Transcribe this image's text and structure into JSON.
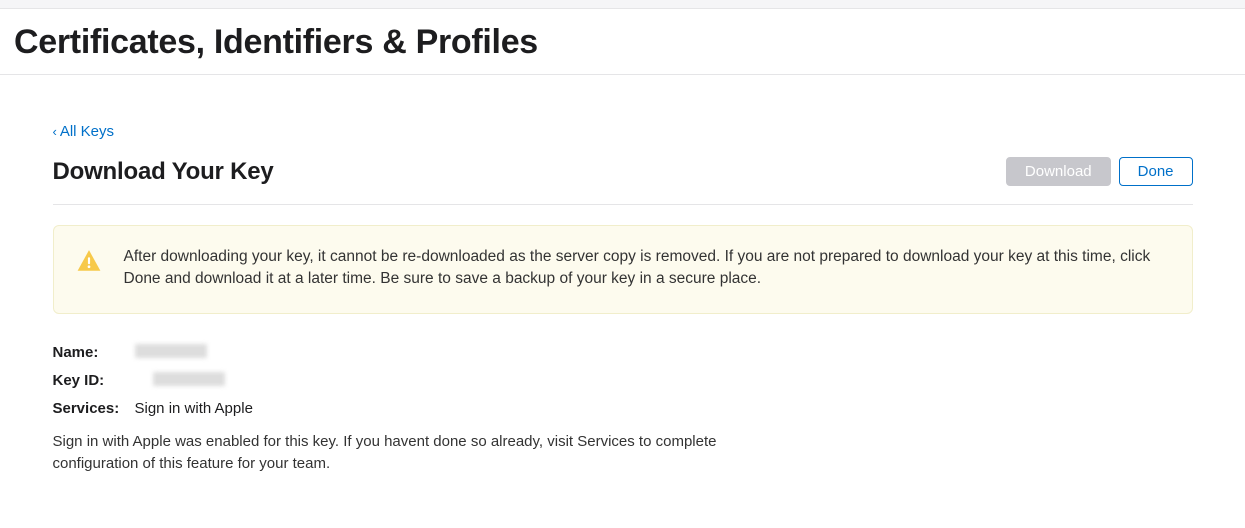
{
  "header": {
    "title": "Certificates, Identifiers & Profiles"
  },
  "back_link": {
    "label": "All Keys"
  },
  "page": {
    "subtitle": "Download Your Key",
    "download_label": "Download",
    "done_label": "Done"
  },
  "alert": {
    "message": "After downloading your key, it cannot be re-downloaded as the server copy is removed. If you are not prepared to download your key at this time, click Done and download it at a later time. Be sure to save a backup of your key in a secure place."
  },
  "details": {
    "name_label": "Name:",
    "name_value": "",
    "keyid_label": "Key ID:",
    "keyid_value": "",
    "services_label": "Services:",
    "services_value": "Sign in with Apple",
    "note": "Sign in with Apple was enabled for this key. If you havent done so already, visit Services to complete configuration of this feature for your team."
  }
}
